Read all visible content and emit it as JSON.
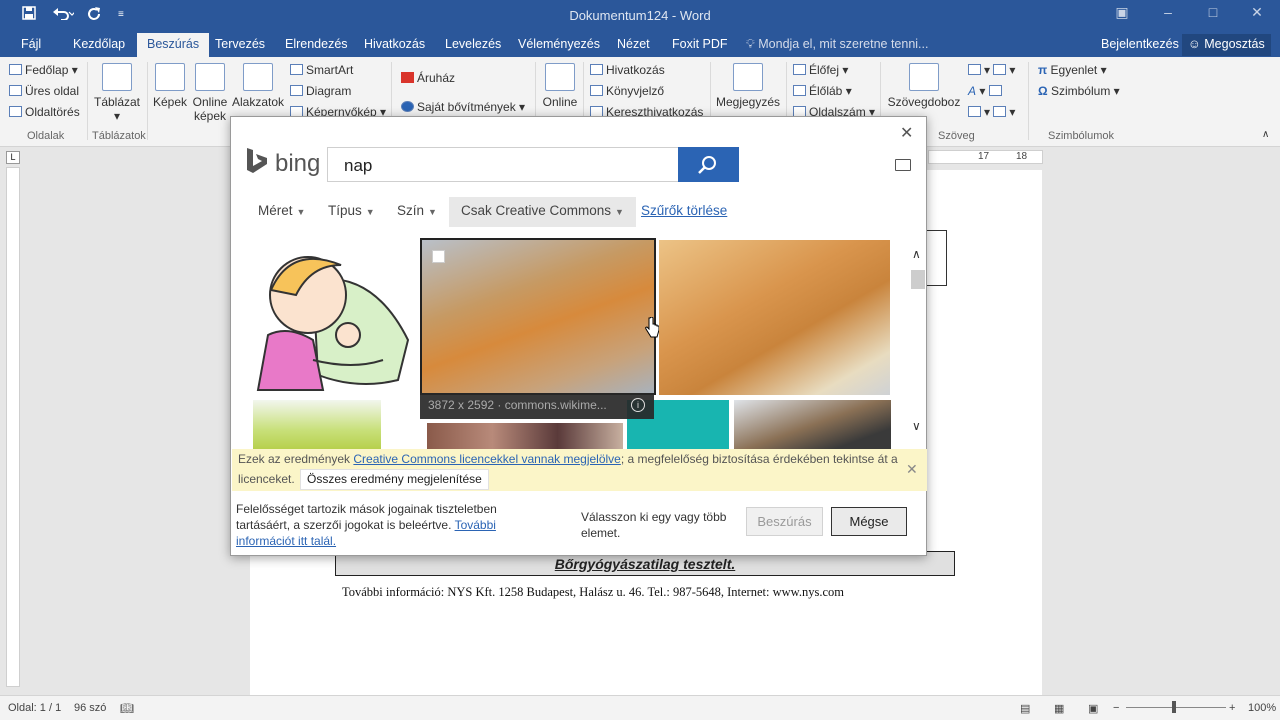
{
  "titlebar": {
    "title": "Dokumentum124 - Word",
    "qat_save": "save-icon",
    "qat_undo": "undo-icon",
    "qat_redo": "redo-icon",
    "accent": "#2b579a"
  },
  "tabs": [
    {
      "label": "Fájl"
    },
    {
      "label": "Kezdőlap"
    },
    {
      "label": "Beszúrás"
    },
    {
      "label": "Tervezés"
    },
    {
      "label": "Elrendezés"
    },
    {
      "label": "Hivatkozás"
    },
    {
      "label": "Levelezés"
    },
    {
      "label": "Véleményezés"
    },
    {
      "label": "Nézet"
    },
    {
      "label": "Foxit PDF"
    }
  ],
  "tellme": "Mondja el, mit szeretne tenni...",
  "signin": "Bejelentkezés",
  "share": "Megosztás",
  "ribbon": {
    "pages": {
      "cover": "Fedőlap",
      "blank": "Üres oldal",
      "break": "Oldaltörés",
      "group": "Oldalak"
    },
    "tables": {
      "table": "Táblázat",
      "group": "Táblázatok"
    },
    "illustrations": {
      "pictures": "Képek",
      "online1": "Online",
      "online2": "képek",
      "shapes": "Alakzatok",
      "smartart": "SmartArt",
      "chart": "Diagram",
      "screenshot": "Képernyőkép"
    },
    "addins": {
      "store": "Áruház",
      "myaddins": "Saját bővítmények"
    },
    "media": {
      "online": "Online"
    },
    "links": {
      "hyperlink": "Hivatkozás",
      "bookmark": "Könyvjelző",
      "crossref": "Kereszthivatkozás"
    },
    "comments": {
      "comment": "Megjegyzés"
    },
    "headerfooter": {
      "header": "Élőfej",
      "footer": "Élőláb",
      "pagenum": "Oldalszám"
    },
    "text": {
      "textbox": "Szövegdoboz",
      "group": "Szöveg"
    },
    "symbols": {
      "equation": "Egyenlet",
      "symbol": "Szimbólum",
      "group": "Szimbólumok"
    }
  },
  "ruler": {
    "h17": "17",
    "h18": "18"
  },
  "dialog": {
    "bing_label": "bing",
    "search_value": "nap",
    "filters": [
      {
        "label": "Méret"
      },
      {
        "label": "Típus"
      },
      {
        "label": "Szín"
      },
      {
        "label": "Csak Creative Commons"
      }
    ],
    "clear_filters": "Szűrők törlése",
    "tooltip": "3872 x 2592 · commons.wikime...",
    "notice": {
      "pre": "Ezek az eredmények ",
      "link": "Creative Commons licencekkel vannak megjelölve",
      "post": "; a megfelelőség biztosítása érdekében tekintse át a licenceket.",
      "show_all": "Összes eredmény megjelenítése"
    },
    "legal_text": "Felelősséget tartozik mások jogainak tiszteletben tartásáért, a szerzői jogokat is beleértve. ",
    "legal_link": "További információt itt talál.",
    "hint": "Válasszon ki egy vagy több elemet.",
    "insert_button": "Beszúrás",
    "cancel_button": "Mégse"
  },
  "document": {
    "banner": "Bőrgyógyászatilag tesztelt.",
    "contact": "További információ: NYS Kft. 1258 Budapest, Halász u. 46. Tel.: 987-5648, Internet: www.nys.com"
  },
  "status": {
    "page": "Oldal: 1 / 1",
    "words": "96 szó",
    "zoom": "100%"
  }
}
